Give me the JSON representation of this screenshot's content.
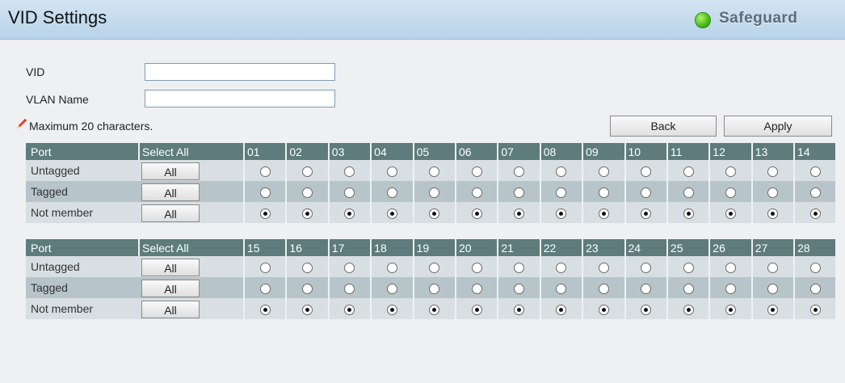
{
  "header": {
    "title": "VID Settings",
    "badge_text": "Safeguard",
    "badge_color": "#4bbf1b"
  },
  "form": {
    "vid_label": "VID",
    "vid_value": "",
    "vlan_name_label": "VLAN Name",
    "vlan_name_value": "",
    "note_icon": "pencil-icon",
    "note": "Maximum 20 characters."
  },
  "buttons": {
    "back": "Back",
    "apply": "Apply"
  },
  "tables": [
    {
      "header": {
        "port": "Port",
        "select_all": "Select All"
      },
      "ports": [
        "01",
        "02",
        "03",
        "04",
        "05",
        "06",
        "07",
        "08",
        "09",
        "10",
        "11",
        "12",
        "13",
        "14"
      ],
      "rows": [
        {
          "label": "Untagged",
          "all_label": "All",
          "checked": false
        },
        {
          "label": "Tagged",
          "all_label": "All",
          "checked": false
        },
        {
          "label": "Not member",
          "all_label": "All",
          "checked": true
        }
      ]
    },
    {
      "header": {
        "port": "Port",
        "select_all": "Select All"
      },
      "ports": [
        "15",
        "16",
        "17",
        "18",
        "19",
        "20",
        "21",
        "22",
        "23",
        "24",
        "25",
        "26",
        "27",
        "28"
      ],
      "rows": [
        {
          "label": "Untagged",
          "all_label": "All",
          "checked": false
        },
        {
          "label": "Tagged",
          "all_label": "All",
          "checked": false
        },
        {
          "label": "Not member",
          "all_label": "All",
          "checked": true
        }
      ]
    }
  ]
}
